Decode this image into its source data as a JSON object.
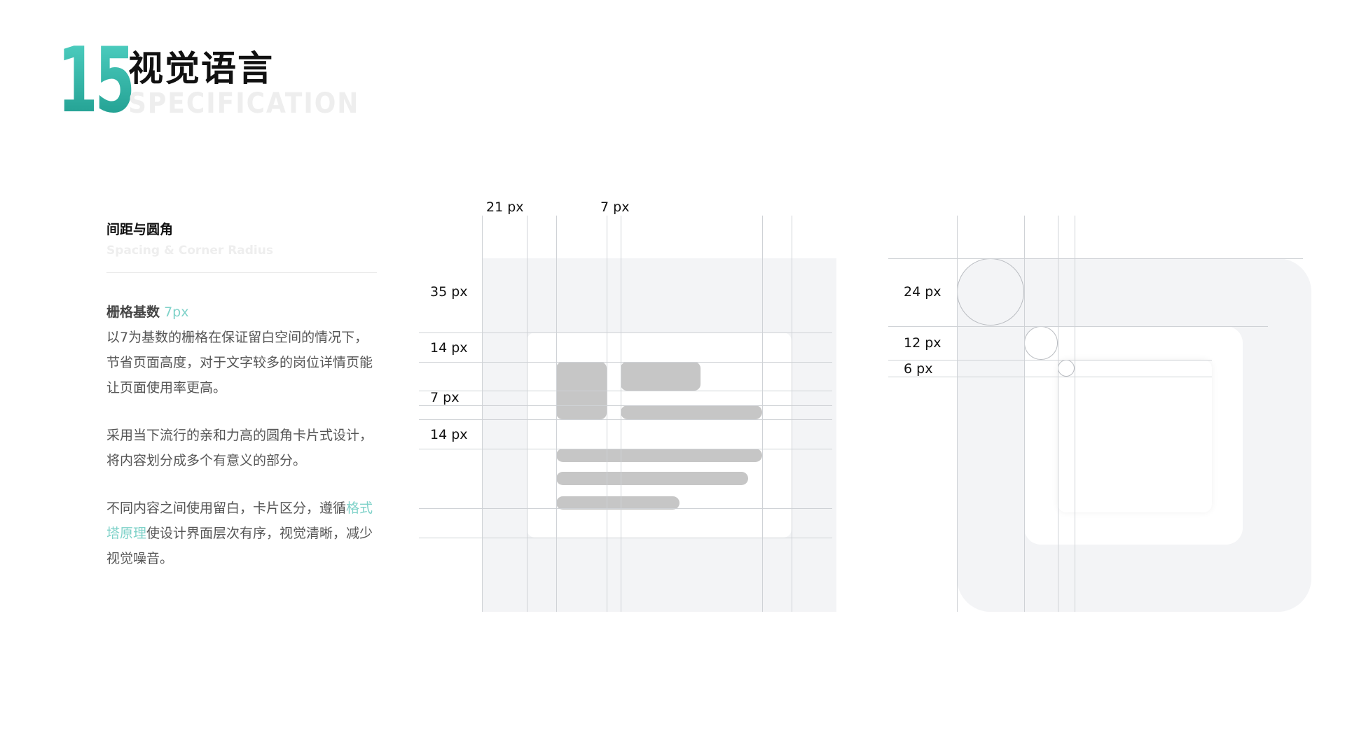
{
  "header": {
    "number": "15",
    "title": "视觉语言",
    "subtitle": "SPECIFICATION"
  },
  "section": {
    "title": "间距与圆角",
    "subtitle": "Spacing & Corner Radius",
    "grid_label": "栅格基数",
    "grid_value": "7px",
    "grid_desc": "以7为基数的栅格在保证留白空间的情况下，节省页面高度，对于文字较多的岗位详情页能让页面使用率更高。",
    "card_desc": "采用当下流行的亲和力高的圆角卡片式设计，将内容划分成多个有意义的部分。",
    "layer_desc_before": "不同内容之间使用留白，卡片区分，遵循",
    "layer_desc_link": "格式塔原理",
    "layer_desc_after": "使设计界面层次有序，视觉清晰，减少视觉噪音。"
  },
  "spacing_diagram": {
    "top_labels": [
      "21 px",
      "7 px"
    ],
    "side_labels": [
      "35 px",
      "14 px",
      "7 px",
      "14 px"
    ]
  },
  "radius_diagram": {
    "side_labels": [
      "24 px",
      "12 px",
      "6 px"
    ]
  },
  "colors": {
    "accent": "#7fd2c9",
    "number_gradient_top": "#4fd0c2",
    "number_gradient_bottom": "#1e9b8d",
    "panel_bg": "#f3f4f6",
    "placeholder": "#c6c6c6",
    "guide_line": "#cfd2d6"
  }
}
